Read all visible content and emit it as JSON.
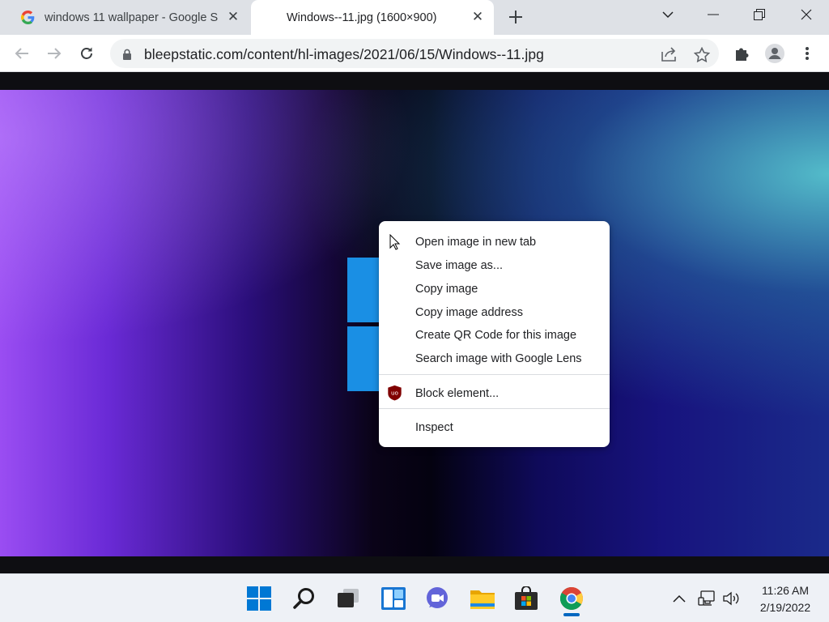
{
  "browser": {
    "tabs": [
      {
        "title": "windows 11 wallpaper - Google S",
        "favicon": "google-g-icon",
        "active": false
      },
      {
        "title": "Windows--11.jpg (1600×900)",
        "active": true
      }
    ],
    "new_tab_icon": "plus-icon",
    "window_controls": [
      "chevron-down-icon",
      "minimize-icon",
      "restore-icon",
      "close-icon"
    ],
    "address_bar": {
      "url": "bleepstatic.com/content/hl-images/2021/06/15/Windows--11.jpg",
      "lock_icon": "lock-icon"
    }
  },
  "context_menu": {
    "items": [
      {
        "label": "Open image in new tab"
      },
      {
        "label": "Save image as..."
      },
      {
        "label": "Copy image"
      },
      {
        "label": "Copy image address"
      },
      {
        "label": "Create QR Code for this image"
      },
      {
        "label": "Search image with Google Lens"
      },
      {
        "label": "Block element...",
        "icon": "ublock-origin-icon"
      },
      {
        "label": "Inspect"
      }
    ]
  },
  "taskbar": {
    "apps": [
      "windows-start-icon",
      "search-icon",
      "task-view-icon",
      "widgets-icon",
      "teams-chat-icon",
      "file-explorer-icon",
      "microsoft-store-icon",
      "chrome-icon"
    ],
    "tray": [
      "chevron-up-icon",
      "network-icon",
      "volume-icon"
    ],
    "clock": {
      "time": "11:26 AM",
      "date": "2/19/2022"
    }
  },
  "colors": {
    "accent": "#0067c0",
    "tabstrip": "#dee1e6",
    "ublock_red": "#800000"
  }
}
